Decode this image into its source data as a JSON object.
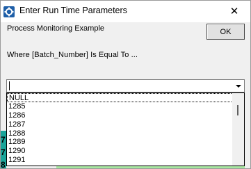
{
  "window": {
    "title": "Enter Run Time Parameters",
    "close_glyph": "✕",
    "icon": "app-gear-icon"
  },
  "dialog": {
    "caption": "Process Monitoring Example",
    "ok_label": "OK",
    "prompt": "Where  [Batch_Number]  Is Equal To ..."
  },
  "combo": {
    "value": ""
  },
  "list": {
    "items": [
      "NULL",
      "1285",
      "1286",
      "1287",
      "1288",
      "1289",
      "1290",
      "1291"
    ]
  },
  "background": {
    "row_numbers": [
      "7",
      "7",
      "8"
    ]
  }
}
